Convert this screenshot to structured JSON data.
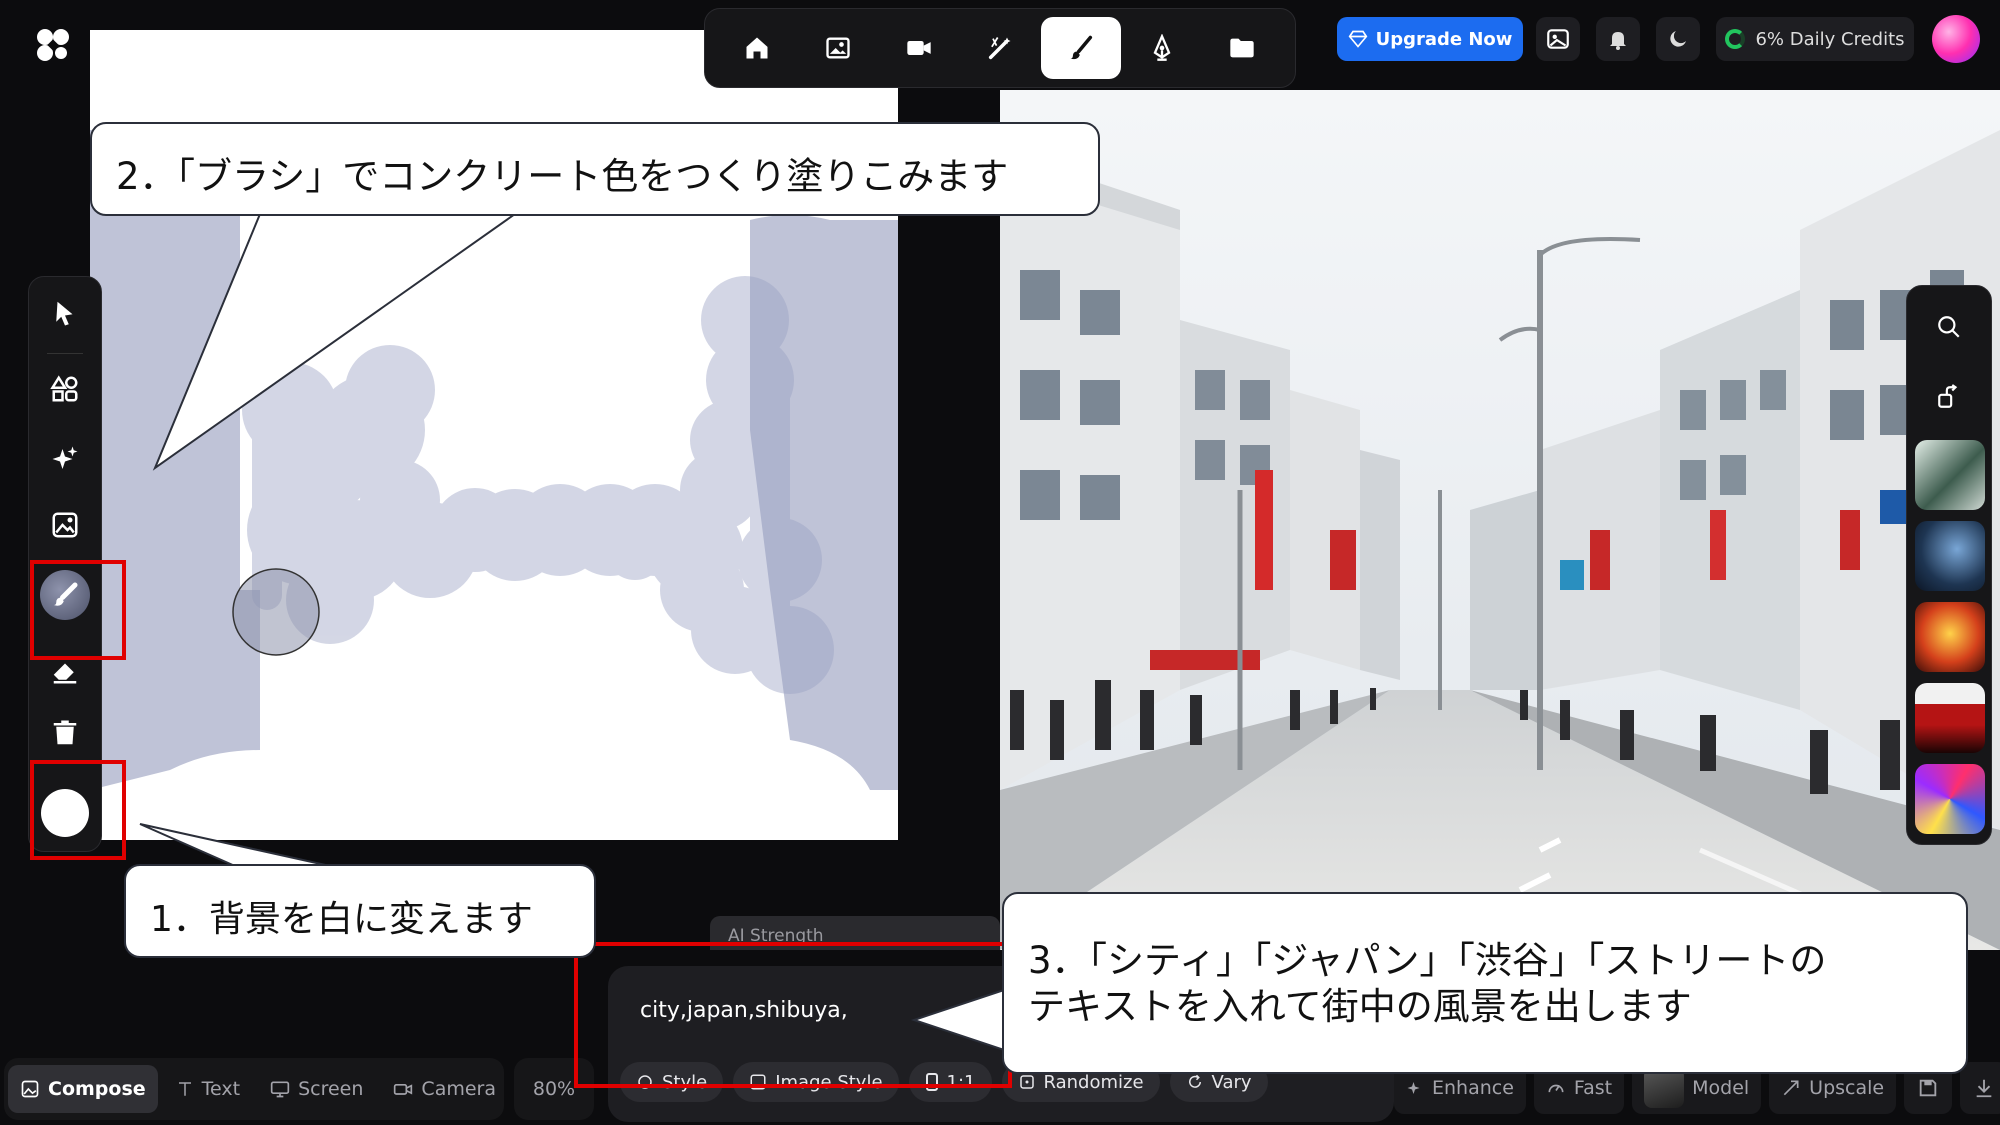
{
  "top_toolbar": {
    "tools": [
      {
        "name": "home-icon"
      },
      {
        "name": "image-icon"
      },
      {
        "name": "video-icon"
      },
      {
        "name": "magic-wand-icon"
      },
      {
        "name": "brush-icon",
        "active": true
      },
      {
        "name": "pen-nib-icon"
      },
      {
        "name": "folder-icon"
      }
    ]
  },
  "header_right": {
    "upgrade_label": "Upgrade Now",
    "credits_label": "6% Daily Credits",
    "credits_percent": 6
  },
  "left_rail": {
    "tools": [
      "pointer-icon",
      "shapes-icon",
      "sparkle-icon",
      "image-upload-icon",
      "brush-icon",
      "eraser-icon",
      "trash-icon",
      "color-swatch"
    ]
  },
  "colors": {
    "brush": "#a9afc9",
    "accent": "#1c6cf0",
    "callout_border": "#2b2f3a",
    "highlight": "#e00000",
    "background_swatch": "#ffffff"
  },
  "prompt": {
    "strength_label": "AI Strength",
    "text": "city,japan,shibuya,",
    "chips": [
      {
        "label": "Style",
        "icon": "style-icon"
      },
      {
        "label": "Image Style",
        "icon": "image-style-icon"
      },
      {
        "label": "1:1",
        "icon": "aspect-ratio-icon"
      },
      {
        "label": "Randomize",
        "icon": "dice-icon"
      },
      {
        "label": "Vary",
        "icon": "refresh-icon"
      }
    ]
  },
  "bottom_tabs": [
    {
      "label": "Compose",
      "active": true
    },
    {
      "label": "Text"
    },
    {
      "label": "Screen"
    },
    {
      "label": "Camera"
    }
  ],
  "zoom_label": "80%",
  "bottom_right_tools": [
    {
      "label": "Enhance",
      "icon": "sparkle-icon"
    },
    {
      "label": "Fast",
      "icon": "gauge-icon"
    },
    {
      "label": "Model",
      "icon": "model-avatar"
    },
    {
      "label": "Upscale",
      "icon": "upscale-icon"
    }
  ],
  "callouts": {
    "step2": "2．「ブラシ」でコンクリート色をつくり塗りこみます",
    "step1": "1．背景を白に変えます",
    "step3_line1": "3．「シティ」「ジャパン」「渋谷」「ストリートの",
    "step3_line2": "テキストを入れて街中の風景を出します"
  }
}
